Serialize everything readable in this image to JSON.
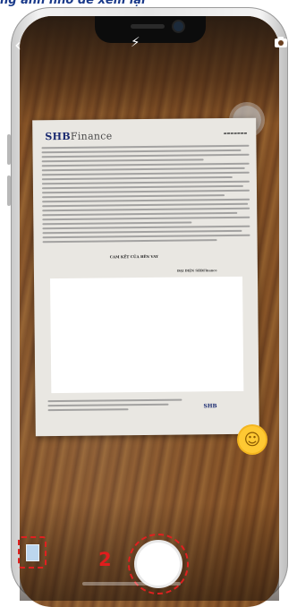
{
  "caption": "ng ảnh nhỏ để xem lại",
  "camera": {
    "back_icon": "chevron-left-icon",
    "flash_icon": "flash-off-icon",
    "switch_icon": "camera-switch-icon"
  },
  "document": {
    "logo_main": "SHB",
    "logo_sub": "Finance",
    "section_heading": "CAM KẾT CỦA BÊN VAY",
    "signer_label": "ĐẠI DIỆN SHBFinance",
    "footer_logo": "SHB"
  },
  "step_number": "2",
  "colors": {
    "accent_red": "#e02020",
    "caption_blue": "#1a3a8a"
  }
}
